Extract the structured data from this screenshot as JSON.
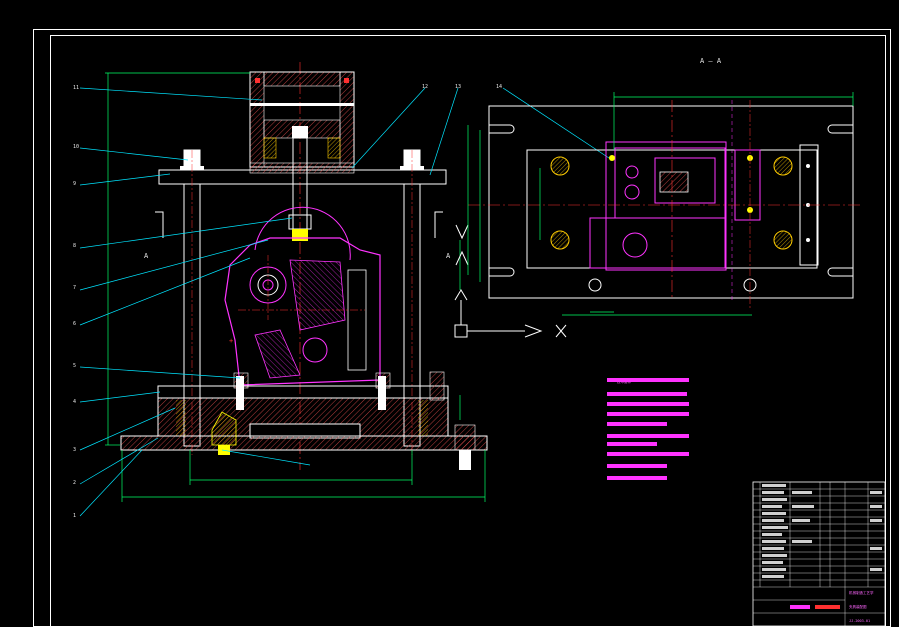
{
  "colors": {
    "background": "#000000",
    "frame": "#ffffff",
    "outline": "#ffffff",
    "hatch": "#ff5555",
    "centerline": "#ff3030",
    "dimension": "#00ff66",
    "leader": "#00e5ff",
    "part": "#ff33ff",
    "bolt": "#ffff00",
    "text": "#e8e8e8"
  },
  "section_label": "A — A",
  "cut_marks": [
    "A",
    "A"
  ],
  "notes_title": "技术要求",
  "notes_lines": 8,
  "title_block": {
    "name": "夹具装配图",
    "school": "机械制造工艺学",
    "drawing_no": "JJ-2003-01"
  },
  "balloons": [
    "11",
    "10",
    "9",
    "8",
    "7",
    "6",
    "5",
    "4",
    "3",
    "2",
    "1",
    "12",
    "13",
    "14"
  ]
}
